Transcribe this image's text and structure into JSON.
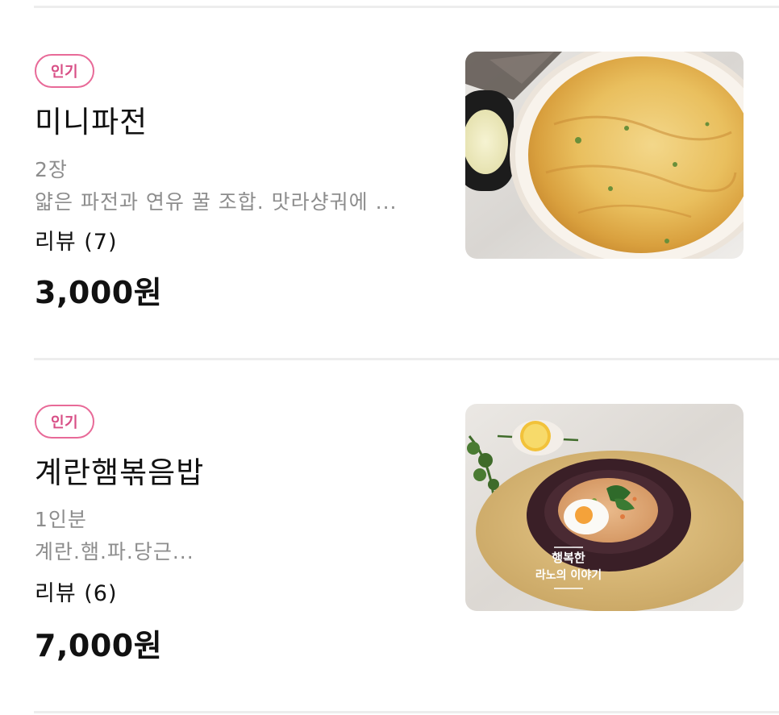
{
  "menu_items": [
    {
      "badge": "인기",
      "name": "미니파전",
      "portion": "2장",
      "description": "얇은 파전과 연유 꿀 조합. 맛라샹궈에 ...",
      "review": "리뷰 (7)",
      "price": "3,000원",
      "image_icon": "pajeon-photo"
    },
    {
      "badge": "인기",
      "name": "계란햄볶음밥",
      "portion": "1인분",
      "description": "계란.햄.파.당근...",
      "review": "리뷰 (6)",
      "price": "7,000원",
      "image_icon": "fried-rice-photo",
      "image_caption_line1": "행복한",
      "image_caption_line2": "라노의 이야기"
    }
  ],
  "colors": {
    "badge_pink": "#e86a98",
    "secondary_text": "#8d8d8d",
    "divider": "#ededed"
  }
}
